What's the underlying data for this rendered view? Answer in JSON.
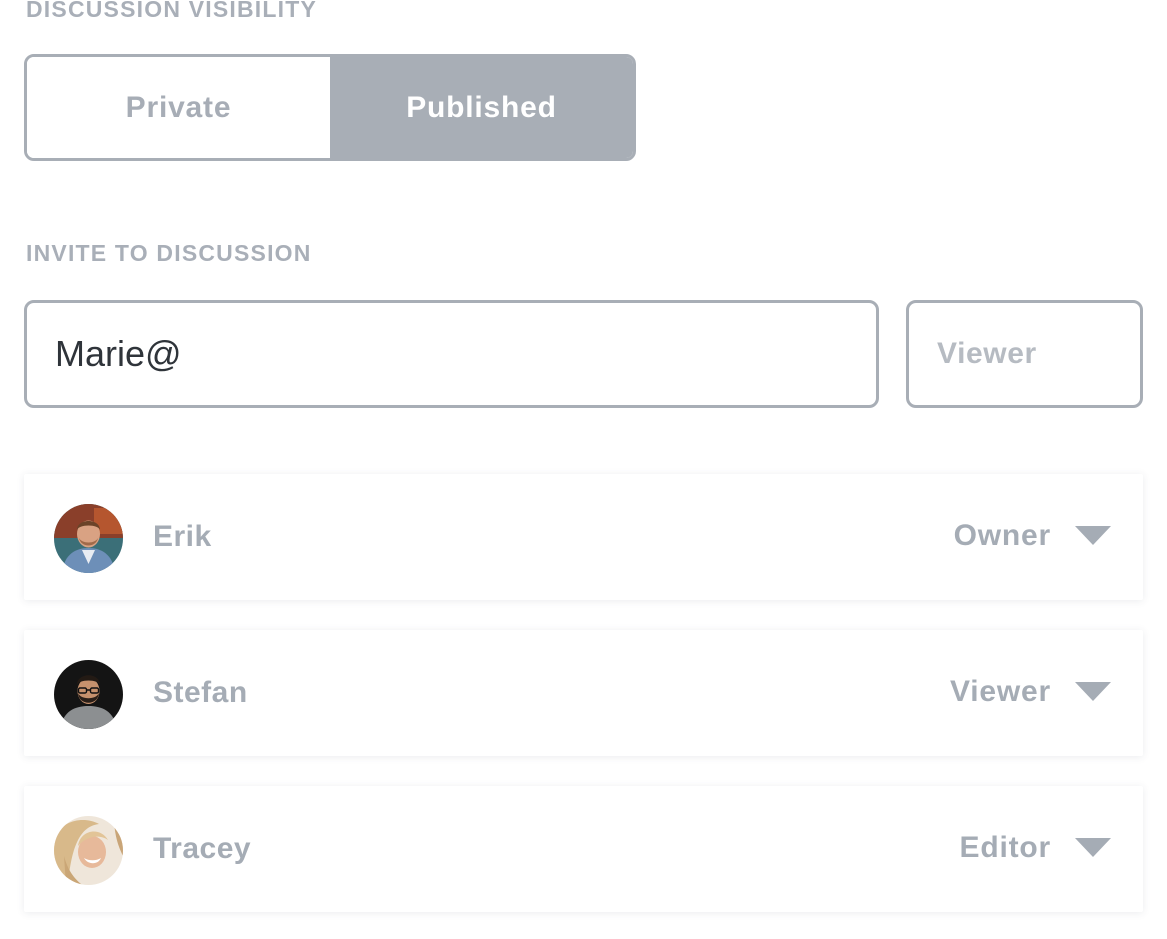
{
  "visibility": {
    "label": "DISCUSSION VISIBILITY",
    "options": [
      {
        "label": "Private",
        "selected": false
      },
      {
        "label": "Published",
        "selected": true
      }
    ]
  },
  "invite": {
    "label": "INVITE TO DISCUSSION",
    "email_value": "Marie@",
    "email_placeholder": "",
    "role_value": "Viewer"
  },
  "members": [
    {
      "name": "Erik",
      "role": "Owner",
      "avatar_icon": "avatar-erik-icon"
    },
    {
      "name": "Stefan",
      "role": "Viewer",
      "avatar_icon": "avatar-stefan-icon"
    },
    {
      "name": "Tracey",
      "role": "Editor",
      "avatar_icon": "avatar-tracey-icon"
    }
  ],
  "colors": {
    "border": "#a8aeb6",
    "muted_text": "#a5acb5",
    "input_text": "#2f343a",
    "selected_fill": "#a8aeb6"
  }
}
